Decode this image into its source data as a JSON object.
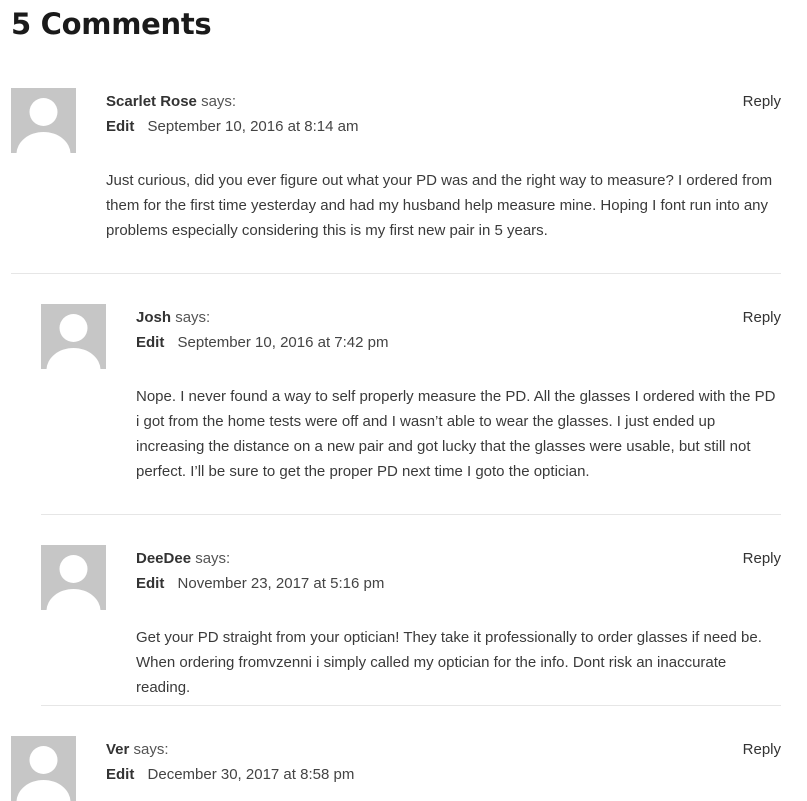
{
  "comments_title": "5 Comments",
  "says_label": "says:",
  "edit_label": "Edit",
  "reply_label": "Reply",
  "comments": [
    {
      "author": "Scarlet Rose",
      "date": "September 10, 2016 at 8:14 am",
      "text": "Just curious, did you ever figure out what your PD was and the right way to measure? I ordered from them for the first time yesterday and had my husband help measure mine. Hoping I font run into any problems especially considering this is my first new pair in 5 years."
    },
    {
      "author": "Josh",
      "date": "September 10, 2016 at 7:42 pm",
      "text": "Nope. I never found a way to self properly measure the PD. All the glasses I ordered with the PD i got from the home tests were off and I wasn’t able to wear the glasses. I just ended up increasing the distance on a new pair and got lucky that the glasses were usable, but still not perfect. I’ll be sure to get the proper PD next time I goto the optician."
    },
    {
      "author": "DeeDee",
      "date": "November 23, 2017 at 5:16 pm",
      "text": "Get your PD straight from your optician! They take it professionally to order glasses if need be. When ordering fromvzenni i simply called my optician for the info. Dont risk an inaccurate reading."
    },
    {
      "author": "Ver",
      "date": "December 30, 2017 at 8:58 pm",
      "text": ""
    }
  ],
  "icons": {
    "avatar": "default-avatar-icon"
  },
  "colors": {
    "avatar_bg": "#c6c6c6",
    "avatar_fg": "#ffffff",
    "divider": "#e6e6e6",
    "text": "#3a3a3a"
  }
}
